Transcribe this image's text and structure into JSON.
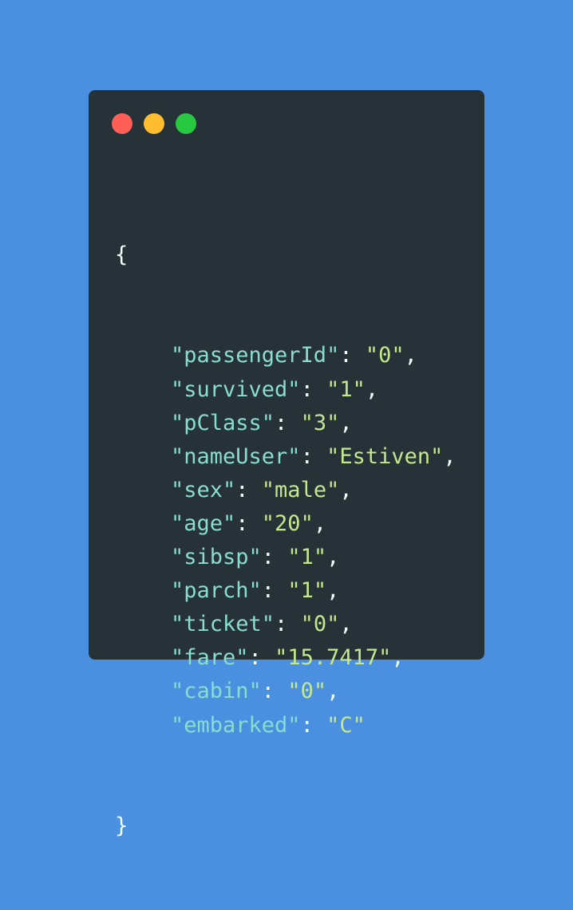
{
  "colors": {
    "background": "#4a8fe0",
    "window": "#263238",
    "close": "#ff5f57",
    "minimize": "#febc2e",
    "maximize": "#28c840",
    "key": "#89ddcf",
    "value": "#c3e88d",
    "punctuation": "#eeffff"
  },
  "window_controls": {
    "close_icon": "close-dot-icon",
    "minimize_icon": "minimize-dot-icon",
    "maximize_icon": "maximize-dot-icon"
  },
  "code": {
    "open_brace": "{",
    "close_brace": "}",
    "entries": [
      {
        "key": "\"passengerId\"",
        "value": "\"0\"",
        "suffix": ","
      },
      {
        "key": "\"survived\"",
        "value": "\"1\"",
        "suffix": ","
      },
      {
        "key": "\"pClass\"",
        "value": "\"3\"",
        "suffix": ","
      },
      {
        "key": "\"nameUser\"",
        "value": "\"Estiven\"",
        "suffix": ","
      },
      {
        "key": "\"sex\"",
        "value": "\"male\"",
        "suffix": ","
      },
      {
        "key": "\"age\"",
        "value": "\"20\"",
        "suffix": ","
      },
      {
        "key": "\"sibsp\"",
        "value": "\"1\"",
        "suffix": ","
      },
      {
        "key": "\"parch\"",
        "value": "\"1\"",
        "suffix": ","
      },
      {
        "key": "\"ticket\"",
        "value": "\"0\"",
        "suffix": ","
      },
      {
        "key": "\"fare\"",
        "value": "\"15.7417\"",
        "suffix": ","
      },
      {
        "key": "\"cabin\"",
        "value": "\"0\"",
        "suffix": ","
      },
      {
        "key": "\"embarked\"",
        "value": "\"C\"",
        "suffix": ""
      }
    ]
  }
}
